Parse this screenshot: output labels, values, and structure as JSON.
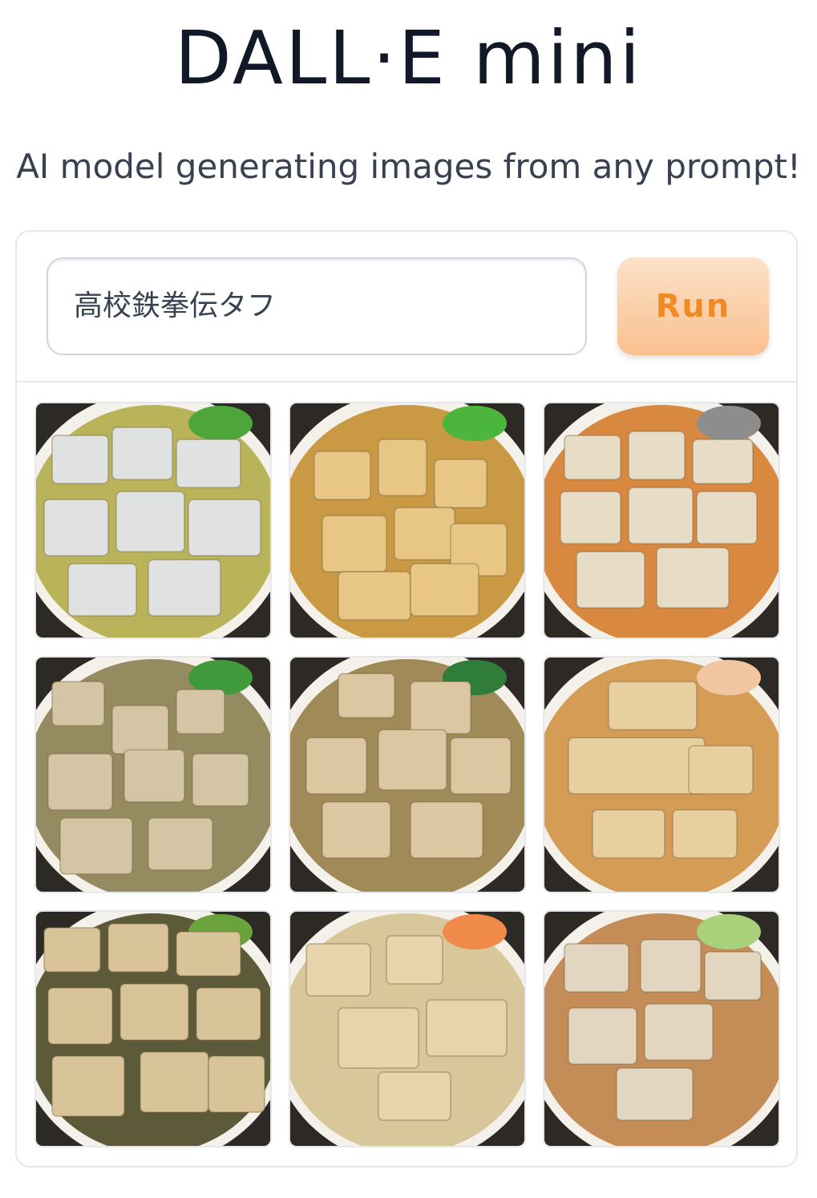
{
  "header": {
    "title": "DALL·E mini",
    "subtitle": "AI model generating images from any prompt!"
  },
  "prompt": {
    "value": "高校鉄拳伝タフ",
    "run_label": "Run"
  },
  "gallery": {
    "images": [
      {
        "description": "white tofu cubes in green broth",
        "broth": "#b9b45a",
        "block": "#dfe2e0",
        "accent": "#4ea63a"
      },
      {
        "description": "fried tofu in golden broth with greens",
        "broth": "#c99a43",
        "block": "#e8c784",
        "accent": "#4cb53c"
      },
      {
        "description": "pale tofu squares in orange broth bowl",
        "broth": "#d8893f",
        "block": "#e7ddc7",
        "accent": "#8d8d8d"
      },
      {
        "description": "tofu cubes in grey-green soup",
        "broth": "#948b61",
        "block": "#d4c6a5",
        "accent": "#3e9a3a"
      },
      {
        "description": "tofu blocks in soup with green leaves",
        "broth": "#9f8a58",
        "block": "#dcc7a2",
        "accent": "#2f7d38"
      },
      {
        "description": "fried tofu slabs in orange broth",
        "broth": "#d49c55",
        "block": "#e8cf9e",
        "accent": "#f1c7a2"
      },
      {
        "description": "stacked tofu pieces",
        "broth": "#5d5a3a",
        "block": "#d9c49a",
        "accent": "#6aa33c"
      },
      {
        "description": "tofu in pale broth with egg",
        "broth": "#d8c79a",
        "block": "#e8d4ac",
        "accent": "#f08a4a"
      },
      {
        "description": "tofu and cabbage in broth",
        "broth": "#c48c56",
        "block": "#e2d6c0",
        "accent": "#a9d07a"
      }
    ]
  }
}
